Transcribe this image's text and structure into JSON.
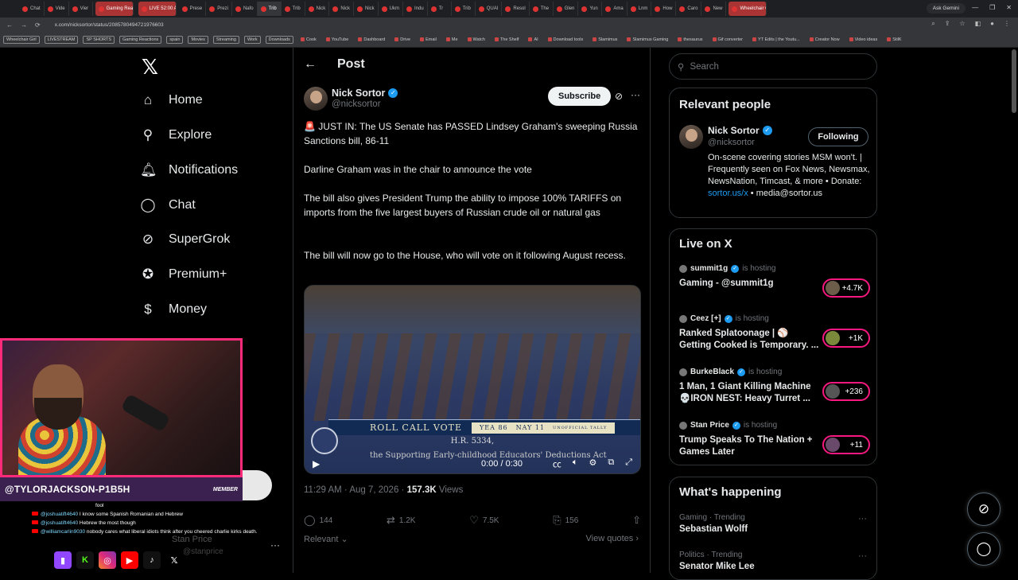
{
  "browser": {
    "tabs": [
      "Chat",
      "Vide",
      "Vier",
      "Gaming Reactions",
      "LIVE 52:00 AM",
      "Prese",
      "Prezi",
      "Nafo",
      "Trib",
      "Trib",
      "Nick",
      "Nick",
      "Nick",
      "Ukm",
      "Indu",
      "Tr",
      "Trib",
      "QUAI",
      "Resol",
      "The ",
      "Glen",
      "Yun",
      "Ama",
      "Lnm",
      "How",
      "Caro",
      "New",
      "Wheelchair Girl"
    ],
    "ask_gemini": "Ask Gemini",
    "url": "x.com/nicksortor/status/2085780494721976603",
    "bookmarks": [
      "Wheelchair Girl",
      "LIVESTREAM",
      "SP SHORTS",
      "Gaming Reactions",
      "spain",
      "Movies",
      "Streaming",
      "Work",
      "Downloads",
      "Cook",
      "YouTube",
      "Dashboard",
      "Drive",
      "Email",
      "Me",
      "Watch",
      "The Shelf",
      "AI",
      "Download tools",
      "Slamimus",
      "Slamimus Gaming",
      "thesaurus",
      "Gif converter",
      "YT Edits | the Youtu...",
      "Creator Now",
      "Video ideas",
      "StilK"
    ]
  },
  "nav": {
    "items": [
      {
        "label": "Home",
        "icon": "home-icon"
      },
      {
        "label": "Explore",
        "icon": "search-icon"
      },
      {
        "label": "Notifications",
        "icon": "bell-icon"
      },
      {
        "label": "Chat",
        "icon": "chat-icon"
      },
      {
        "label": "SuperGrok",
        "icon": "grok-icon"
      },
      {
        "label": "Premium+",
        "icon": "premium-icon"
      },
      {
        "label": "Money",
        "icon": "money-icon"
      }
    ]
  },
  "post": {
    "header": "Post",
    "author_name": "Nick Sortor",
    "author_handle": "@nicksortor",
    "subscribe_label": "Subscribe",
    "para1": "🚨 JUST IN: The US Senate has PASSED Lindsey Graham's sweeping Russia Sanctions bill, 86-11",
    "para2": "Darline Graham was in the chair to announce the vote",
    "para3": "The bill also gives President Trump the ability to impose 100% TARIFFS on imports from the five largest buyers of Russian crude oil or natural gas",
    "para4": "The bill will now go to the House, who will vote on it following August recess.",
    "video": {
      "rollcall": "ROLL CALL VOTE",
      "yea": "YEA 86",
      "nay": "NAY 11",
      "unofficial": "UNOFFICIAL TALLY",
      "bill_no": "H.R. 5334,",
      "bill_name": "the Supporting Early-childhood Educators' Deductions Act",
      "time": "0:00 / 0:30"
    },
    "time": "11:29 AM · Aug 7, 2026 · ",
    "views_count": "157.3K",
    "views_label": " Views",
    "replies": "144",
    "reposts": "1.2K",
    "likes": "7.5K",
    "bookmarks": "156",
    "relevant_label": "Relevant",
    "quotes_label": "View quotes"
  },
  "sidebar": {
    "search_placeholder": "Search",
    "relevant_title": "Relevant people",
    "person": {
      "name": "Nick Sortor",
      "handle": "@nicksortor",
      "follow_label": "Following",
      "bio": "On-scene covering stories MSM won't. | Frequently seen on Fox News, Newsmax, NewsNation, Timcast, & more • Donate: ",
      "bio_link": "sortor.us/x",
      "bio_tail": " • media@sortor.us"
    },
    "live_title": "Live on X",
    "live": [
      {
        "host": "summit1g",
        "hosting": "is hosting",
        "title": "Gaming - @summit1g",
        "count": "+4.7K"
      },
      {
        "host": "Ceez [+]",
        "hosting": "is hosting",
        "title": "Ranked Splatoonage | ⚾ Getting Cooked is Temporary. ...",
        "count": "+1K"
      },
      {
        "host": "BurkeBlack",
        "hosting": "is hosting",
        "title": "1 Man, 1 Giant Killing Machine 💀IRON NEST: Heavy Turret ...",
        "count": "+236"
      },
      {
        "host": "Stan Price",
        "hosting": "is hosting",
        "title": "Trump Speaks To The Nation + Games Later",
        "count": "+11"
      }
    ],
    "happening_title": "What's happening",
    "trends": [
      {
        "category": "Gaming · Trending",
        "name": "Sebastian Wolff"
      },
      {
        "category": "Politics · Trending",
        "name": "Senator Mike Lee"
      }
    ]
  },
  "overlay": {
    "streamer_name": "@TYLORJACKSON-P1B5H",
    "member_badge": "MEMBER",
    "chat": [
      {
        "user": "",
        "text": "fool"
      },
      {
        "user": "@joshuatift4640",
        "text": "I know some Spanish Romanian and Hebrew"
      },
      {
        "user": "@joshuatift4640",
        "text": "Hebrew the most though"
      },
      {
        "user": "@williamcarlin9030",
        "text": "nobody cares what liberal idiots think after you cheered charlie kirks death."
      }
    ],
    "ghost_name": "Stan Price",
    "ghost_handle": "@stanprice"
  }
}
